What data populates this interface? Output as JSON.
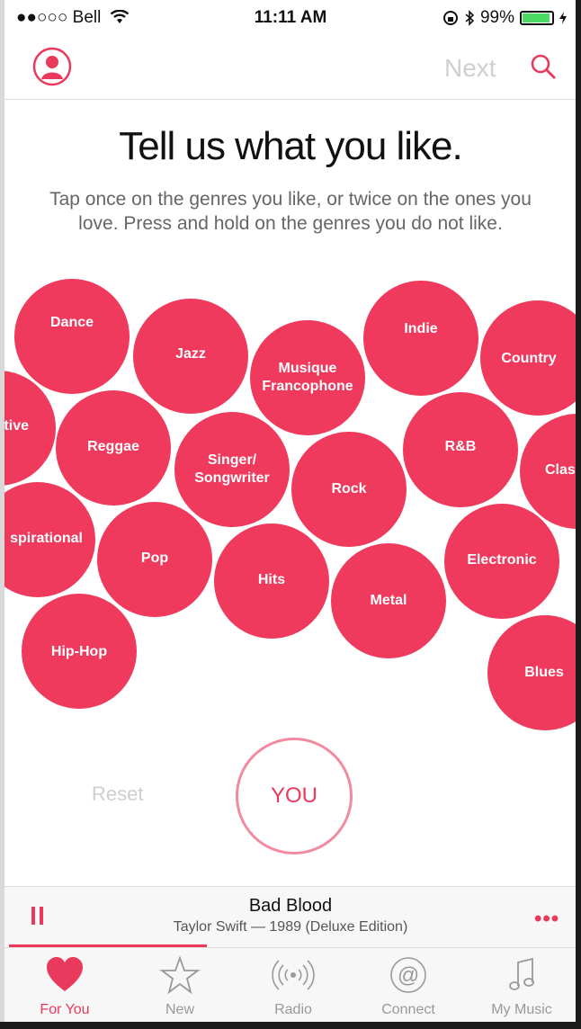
{
  "status_bar": {
    "carrier": "●●○○○ Bell",
    "time": "11:11 AM",
    "battery": "99%"
  },
  "nav": {
    "next_label": "Next"
  },
  "title": "Tell us what you like.",
  "subtitle": "Tap once on the genres you like, or twice on the ones you love. Press and hold on the genres you do not like.",
  "genres": {
    "dance": "Dance",
    "jazz": "Jazz",
    "musique": "Musique Francophone",
    "indie": "Indie",
    "country": "Country",
    "alternative": "tive",
    "reggae": "Reggae",
    "singer": "Singer/ Songwriter",
    "rock": "Rock",
    "rnb": "R&B",
    "classical": "Class",
    "inspirational": "spirational",
    "pop": "Pop",
    "hits": "Hits",
    "metal": "Metal",
    "electronic": "Electronic",
    "hiphop": "Hip-Hop",
    "blues": "Blues"
  },
  "reset_label": "Reset",
  "you_label": "YOU",
  "now_playing": {
    "song": "Bad Blood",
    "artist": "Taylor Swift — 1989 (Deluxe Edition)",
    "more": "•••"
  },
  "tabs": {
    "for_you": "For You",
    "new": "New",
    "radio": "Radio",
    "connect": "Connect",
    "my_music": "My Music"
  },
  "colors": {
    "accent": "#ef3a5d",
    "inactive": "#999999"
  }
}
